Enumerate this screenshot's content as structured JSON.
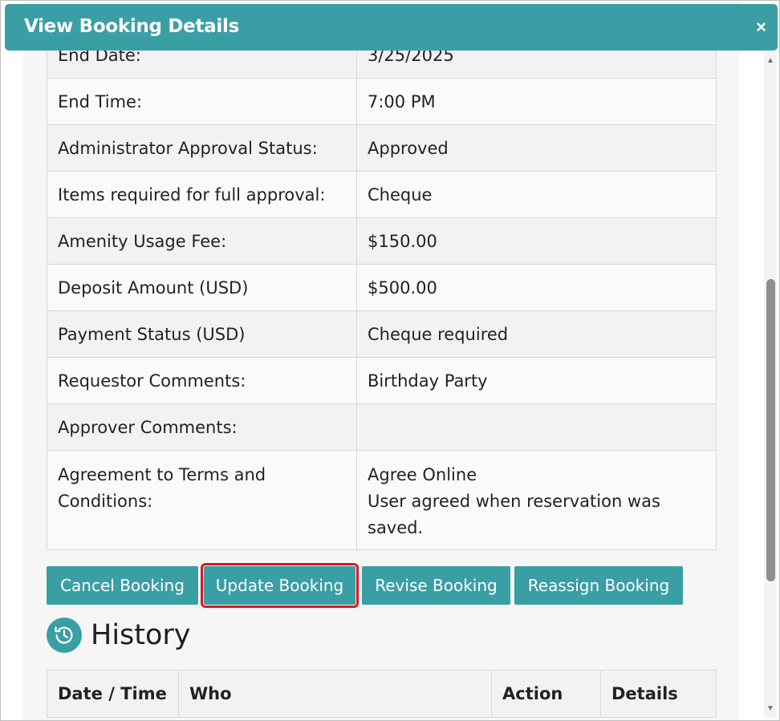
{
  "dialog": {
    "title": "View Booking Details",
    "close": "×"
  },
  "details": [
    {
      "label": "End Date:",
      "value": "3/25/2025"
    },
    {
      "label": "End Time:",
      "value": "7:00 PM"
    },
    {
      "label": "Administrator Approval Status:",
      "value": "Approved"
    },
    {
      "label": "Items required for full approval:",
      "value": "Cheque"
    },
    {
      "label": "Amenity Usage Fee:",
      "value": "$150.00"
    },
    {
      "label": "Deposit Amount (USD)",
      "value": "$500.00"
    },
    {
      "label": "Payment Status (USD)",
      "value": "Cheque required"
    },
    {
      "label": "Requestor Comments:",
      "value": "Birthday Party"
    },
    {
      "label": "Approver Comments:",
      "value": ""
    },
    {
      "label_line1": "Agreement to Terms and",
      "label_line2": "Conditions:",
      "value_line1": "Agree Online",
      "value_line2": "User agreed when reservation was",
      "value_line3": "saved."
    }
  ],
  "buttons": {
    "cancel": "Cancel Booking",
    "update": "Update Booking",
    "revise": "Revise Booking",
    "reassign": "Reassign Booking"
  },
  "history": {
    "title": "History",
    "columns": [
      "Date / Time",
      "Who",
      "Action",
      "Details"
    ]
  },
  "colors": {
    "accent": "#3a9fa5",
    "highlight": "#e0161c"
  }
}
